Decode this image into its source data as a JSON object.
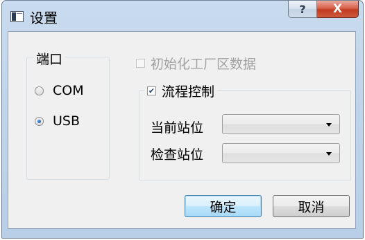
{
  "window": {
    "title": "设置",
    "help_label": "?",
    "close_label": "X"
  },
  "port_group": {
    "title": "端口",
    "options": [
      {
        "label": "COM",
        "checked": false
      },
      {
        "label": "USB",
        "checked": true
      }
    ]
  },
  "init_factory": {
    "label": "初始化工厂区数据",
    "checked": false,
    "enabled": false
  },
  "flow_control": {
    "label": "流程控制",
    "checked": true,
    "current_station_label": "当前站位",
    "current_station_value": "",
    "check_station_label": "检查站位",
    "check_station_value": ""
  },
  "buttons": {
    "ok_label": "确定",
    "cancel_label": "取消"
  },
  "colors": {
    "titlebar": "#bfd4ea",
    "client_bg": "#f0f0f0",
    "close_button": "#c13b20",
    "default_button_border": "#3c7fb1"
  }
}
